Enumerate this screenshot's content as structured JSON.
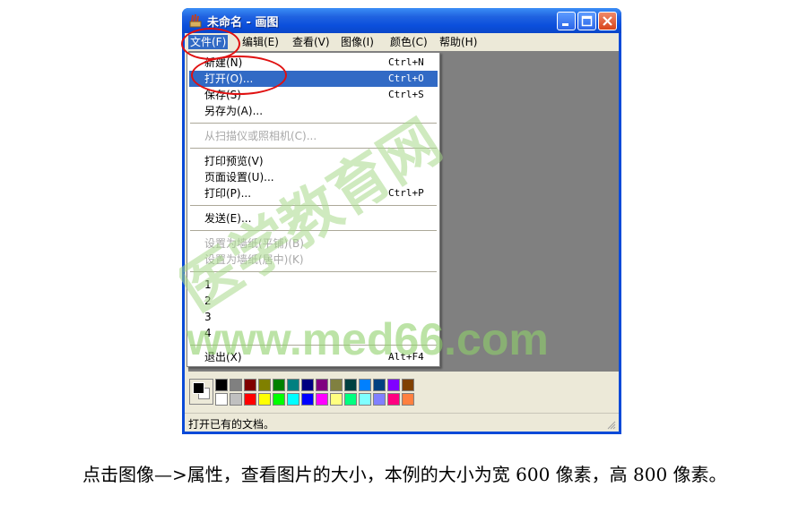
{
  "window": {
    "title": "未命名 - 画图",
    "menus": [
      "文件(F)",
      "编辑(E)",
      "查看(V)",
      "图像(I)",
      "颜色(C)",
      "帮助(H)"
    ],
    "status": "打开已有的文档。"
  },
  "file_menu": {
    "items": [
      {
        "label": "新建(N)",
        "accel": "Ctrl+N",
        "state": "normal"
      },
      {
        "label": "打开(O)...",
        "accel": "Ctrl+O",
        "state": "highlighted"
      },
      {
        "label": "保存(S)",
        "accel": "Ctrl+S",
        "state": "normal"
      },
      {
        "label": "另存为(A)...",
        "accel": "",
        "state": "normal"
      },
      {
        "label": "从扫描仪或照相机(C)...",
        "accel": "",
        "state": "disabled"
      },
      {
        "label": "打印预览(V)",
        "accel": "",
        "state": "normal"
      },
      {
        "label": "页面设置(U)...",
        "accel": "",
        "state": "normal"
      },
      {
        "label": "打印(P)...",
        "accel": "Ctrl+P",
        "state": "normal"
      },
      {
        "label": "发送(E)...",
        "accel": "",
        "state": "normal"
      },
      {
        "label": "设置为墙纸(平铺)(B)",
        "accel": "",
        "state": "disabled"
      },
      {
        "label": "设置为墙纸(居中)(K)",
        "accel": "",
        "state": "disabled"
      },
      {
        "label": "1",
        "accel": "",
        "state": "normal"
      },
      {
        "label": "2",
        "accel": "",
        "state": "normal"
      },
      {
        "label": "3",
        "accel": "",
        "state": "normal"
      },
      {
        "label": "4",
        "accel": "",
        "state": "normal"
      },
      {
        "label": "退出(X)",
        "accel": "Alt+F4",
        "state": "normal"
      }
    ]
  },
  "palette": {
    "colors": [
      "#000000",
      "#808080",
      "#800000",
      "#808000",
      "#008000",
      "#008080",
      "#000080",
      "#800080",
      "#808040",
      "#004040",
      "#0080ff",
      "#004080",
      "#8000ff",
      "#804000",
      "#ffffff",
      "#c0c0c0",
      "#ff0000",
      "#ffff00",
      "#00ff00",
      "#00ffff",
      "#0000ff",
      "#ff00ff",
      "#ffff80",
      "#00ff80",
      "#80ffff",
      "#8080ff",
      "#ff0080",
      "#ff8040"
    ]
  },
  "watermark": {
    "cn": "医学教育网",
    "url": "www.med66.com"
  },
  "caption": "点击图像—>属性，查看图片的大小，本例的大小为宽 600 像素，高 800 像素。"
}
